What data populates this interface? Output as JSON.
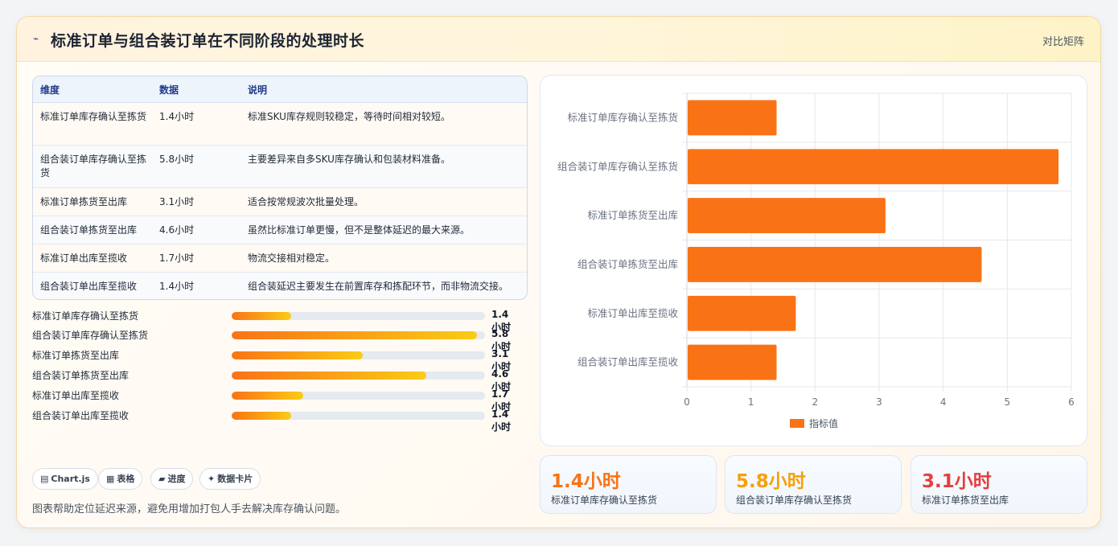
{
  "header": {
    "title": "标准订单与组合装订单在不同阶段的处理时长",
    "right_label": "对比矩阵",
    "icon": "sparkline-icon"
  },
  "table": {
    "columns": [
      "维度",
      "数据",
      "说明"
    ],
    "rows": [
      {
        "dim": "标准订单库存确认至拣货",
        "data": "1.4小时",
        "desc": "标准SKU库存规则较稳定，等待时间相对较短。"
      },
      {
        "dim": "组合装订单库存确认至拣货",
        "data": "5.8小时",
        "desc": "主要差异来自多SKU库存确认和包装材料准备。"
      },
      {
        "dim": "标准订单拣货至出库",
        "data": "3.1小时",
        "desc": "适合按常规波次批量处理。"
      },
      {
        "dim": "组合装订单拣货至出库",
        "data": "4.6小时",
        "desc": "虽然比标准订单更慢，但不是整体延迟的最大来源。"
      },
      {
        "dim": "标准订单出库至揽收",
        "data": "1.7小时",
        "desc": "物流交接相对稳定。"
      },
      {
        "dim": "组合装订单出库至揽收",
        "data": "1.4小时",
        "desc": "组合装延迟主要发生在前置库存和拣配环节，而非物流交接。"
      }
    ]
  },
  "progress": {
    "max": 6,
    "items": [
      {
        "label": "标准订单库存确认至拣货",
        "value": 1.4,
        "display": "1.4小时"
      },
      {
        "label": "组合装订单库存确认至拣货",
        "value": 5.8,
        "display": "5.8小时"
      },
      {
        "label": "标准订单拣货至出库",
        "value": 3.1,
        "display": "3.1小时"
      },
      {
        "label": "组合装订单拣货至出库",
        "value": 4.6,
        "display": "4.6小时"
      },
      {
        "label": "标准订单出库至揽收",
        "value": 1.7,
        "display": "1.7小时"
      },
      {
        "label": "组合装订单出库至揽收",
        "value": 1.4,
        "display": "1.4小时"
      }
    ]
  },
  "pills": [
    {
      "icon": "chart-icon",
      "glyph": "▤",
      "label": "Chart.js"
    },
    {
      "icon": "table-icon",
      "glyph": "▦",
      "label": "表格"
    },
    {
      "icon": "progress-icon",
      "glyph": "▰",
      "label": "进度"
    },
    {
      "icon": "sparkle-icon",
      "glyph": "✦",
      "label": "数据卡片"
    }
  ],
  "note": "图表帮助定位延迟来源，避免用增加打包人手去解决库存确认问题。",
  "chart_data": {
    "type": "bar",
    "orientation": "horizontal",
    "categories": [
      "标准订单库存确认至拣货",
      "组合装订单库存确认至拣货",
      "标准订单拣货至出库",
      "组合装订单拣货至出库",
      "标准订单出库至揽收",
      "组合装订单出库至揽收"
    ],
    "series": [
      {
        "name": "指标值",
        "values": [
          1.4,
          5.8,
          3.1,
          4.6,
          1.7,
          1.4
        ]
      }
    ],
    "xlim": [
      0,
      6
    ],
    "xticks": [
      "0",
      "1",
      "2",
      "3",
      "4",
      "5",
      "6"
    ],
    "grid": true,
    "legend": "bottom",
    "bar_color": "#f97316"
  },
  "kpis": [
    {
      "value": "1.4小时",
      "label": "标准订单库存确认至拣货",
      "color": "#f97316"
    },
    {
      "value": "5.8小时",
      "label": "组合装订单库存确认至拣货",
      "color": "#f5a00b"
    },
    {
      "value": "3.1小时",
      "label": "标准订单拣货至出库",
      "color": "#e53e3e"
    }
  ]
}
